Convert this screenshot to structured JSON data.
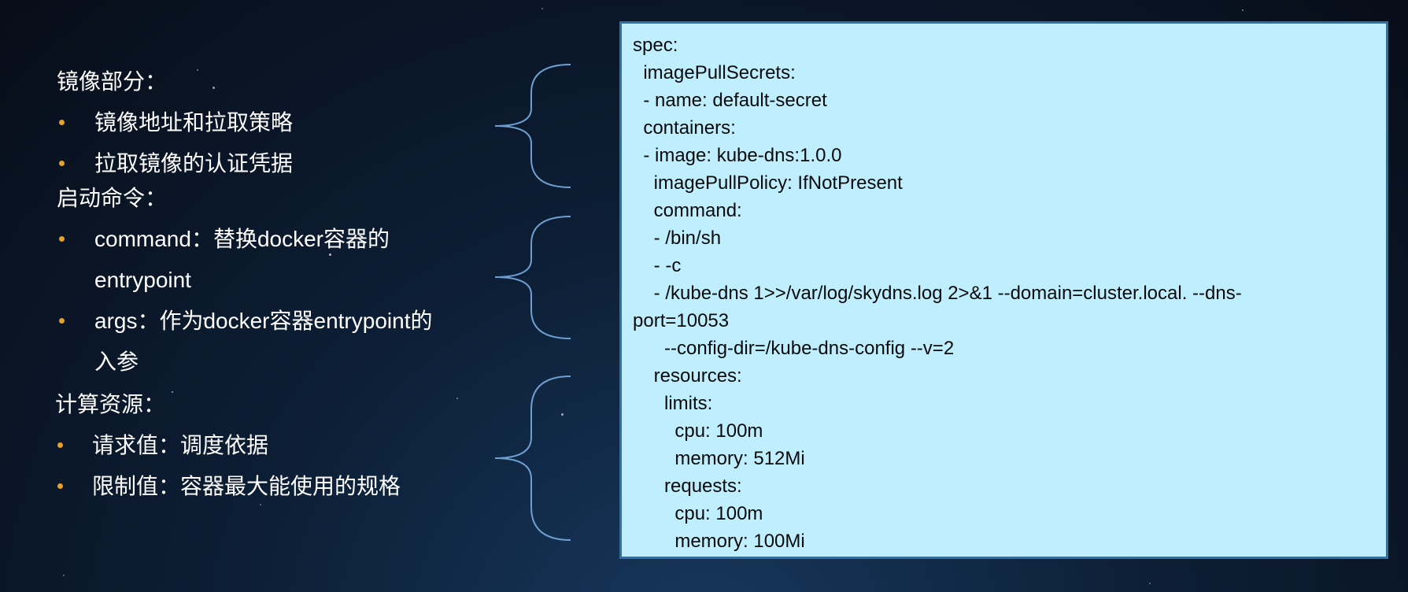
{
  "sections": [
    {
      "heading": "镜像部分：",
      "bullets": [
        {
          "lines": [
            "镜像地址和拉取策略"
          ]
        },
        {
          "lines": [
            "拉取镜像的认证凭据"
          ]
        }
      ]
    },
    {
      "heading": "启动命令：",
      "bullets": [
        {
          "lines": [
            "command：替换docker容器的",
            "entrypoint"
          ]
        },
        {
          "lines": [
            "args：作为docker容器entrypoint的",
            "入参"
          ]
        }
      ]
    },
    {
      "heading": "计算资源：",
      "bullets": [
        {
          "lines": [
            "请求值：调度依据"
          ]
        },
        {
          "lines": [
            "限制值：容器最大能使用的规格"
          ]
        }
      ]
    }
  ],
  "code_lines": [
    "spec:",
    "  imagePullSecrets:",
    "  - name: default-secret",
    "  containers:",
    "  - image: kube-dns:1.0.0",
    "    imagePullPolicy: IfNotPresent",
    "    command:",
    "    - /bin/sh",
    "    - -c",
    "    - /kube-dns 1>>/var/log/skydns.log 2>&1 --domain=cluster.local. --dns-",
    "port=10053",
    "      --config-dir=/kube-dns-config --v=2",
    "    resources:",
    "      limits:",
    "        cpu: 100m",
    "        memory: 512Mi",
    "      requests:",
    "        cpu: 100m",
    "        memory: 100Mi"
  ],
  "colors": {
    "background": "#0d1f36",
    "text": "#ffffff",
    "bullet": "#e8a128",
    "code_background": "#bfeeff",
    "code_border": "#2f6fa8",
    "brace": "#6f9fd0"
  }
}
